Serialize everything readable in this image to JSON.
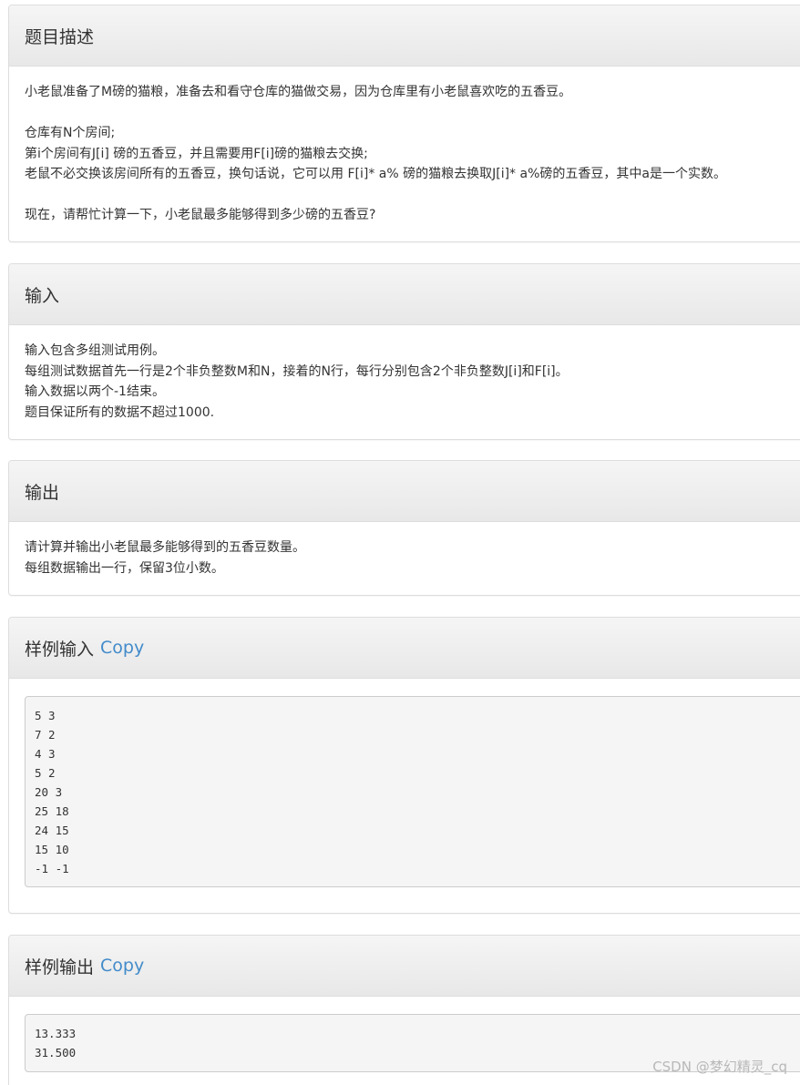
{
  "sections": {
    "description": {
      "title": "题目描述",
      "lines": [
        "小老鼠准备了M磅的猫粮，准备去和看守仓库的猫做交易，因为仓库里有小老鼠喜欢吃的五香豆。",
        "",
        "仓库有N个房间;",
        "第i个房间有J[i] 磅的五香豆，并且需要用F[i]磅的猫粮去交换;",
        "老鼠不必交换该房间所有的五香豆，换句话说，它可以用 F[i]* a% 磅的猫粮去换取J[i]* a%磅的五香豆，其中a是一个实数。",
        "",
        "现在，请帮忙计算一下，小老鼠最多能够得到多少磅的五香豆?"
      ]
    },
    "input": {
      "title": "输入",
      "lines": [
        "输入包含多组测试用例。",
        "每组测试数据首先一行是2个非负整数M和N，接着的N行，每行分别包含2个非负整数J[i]和F[i]。",
        "输入数据以两个-1结束。",
        "题目保证所有的数据不超过1000."
      ]
    },
    "output": {
      "title": "输出",
      "lines": [
        "请计算并输出小老鼠最多能够得到的五香豆数量。",
        "每组数据输出一行，保留3位小数。"
      ]
    },
    "sample_input": {
      "title": "样例输入",
      "copy_label": "Copy",
      "content": "5 3\n7 2\n4 3\n5 2\n20 3\n25 18\n24 15\n15 10\n-1 -1"
    },
    "sample_output": {
      "title": "样例输出",
      "copy_label": "Copy",
      "content": "13.333\n31.500"
    }
  },
  "watermark": "CSDN @梦幻精灵_cq"
}
